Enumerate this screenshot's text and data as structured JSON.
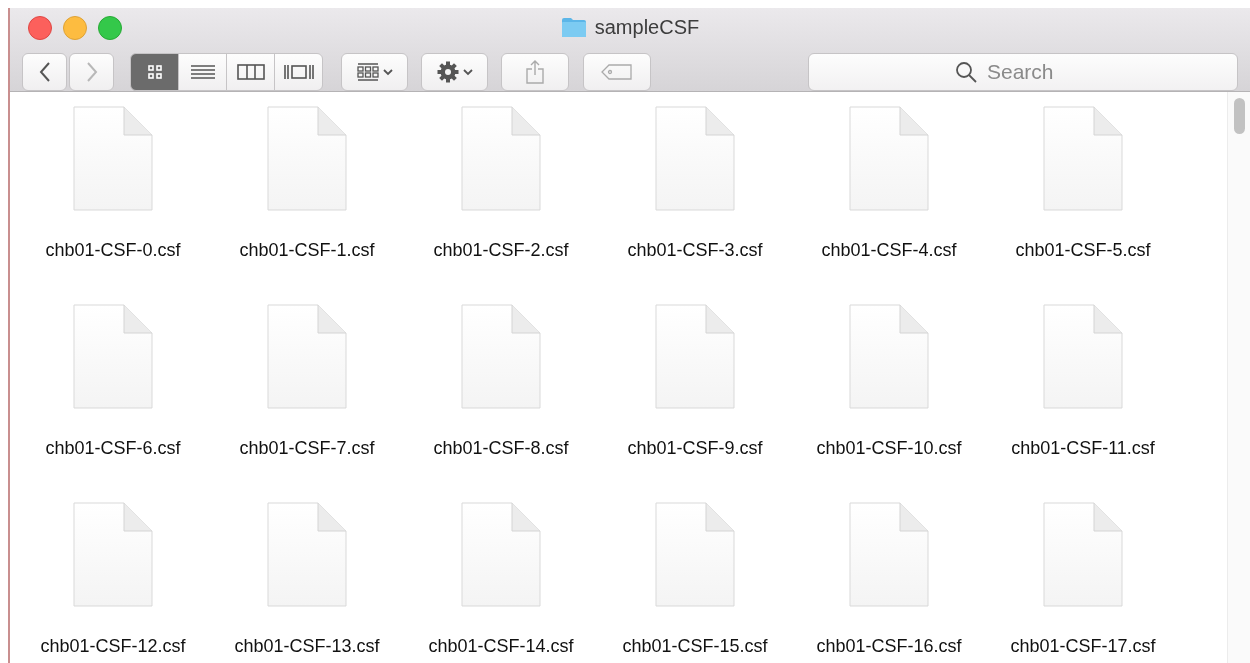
{
  "window": {
    "title": "sampleCSF"
  },
  "toolbar": {
    "nav": [
      {
        "kind": "back",
        "disabled": false
      },
      {
        "kind": "forward",
        "disabled": true
      }
    ],
    "view_modes": [
      {
        "kind": "icons",
        "selected": true
      },
      {
        "kind": "list",
        "selected": false
      },
      {
        "kind": "columns",
        "selected": false
      },
      {
        "kind": "coverflow",
        "selected": false
      }
    ],
    "search": {
      "placeholder": "Search"
    }
  },
  "files": [
    {
      "name": "chb01-CSF-0.csf"
    },
    {
      "name": "chb01-CSF-1.csf"
    },
    {
      "name": "chb01-CSF-2.csf"
    },
    {
      "name": "chb01-CSF-3.csf"
    },
    {
      "name": "chb01-CSF-4.csf"
    },
    {
      "name": "chb01-CSF-5.csf"
    },
    {
      "name": "chb01-CSF-6.csf"
    },
    {
      "name": "chb01-CSF-7.csf"
    },
    {
      "name": "chb01-CSF-8.csf"
    },
    {
      "name": "chb01-CSF-9.csf"
    },
    {
      "name": "chb01-CSF-10.csf"
    },
    {
      "name": "chb01-CSF-11.csf"
    },
    {
      "name": "chb01-CSF-12.csf"
    },
    {
      "name": "chb01-CSF-13.csf"
    },
    {
      "name": "chb01-CSF-14.csf"
    },
    {
      "name": "chb01-CSF-15.csf"
    },
    {
      "name": "chb01-CSF-16.csf"
    },
    {
      "name": "chb01-CSF-17.csf"
    }
  ]
}
